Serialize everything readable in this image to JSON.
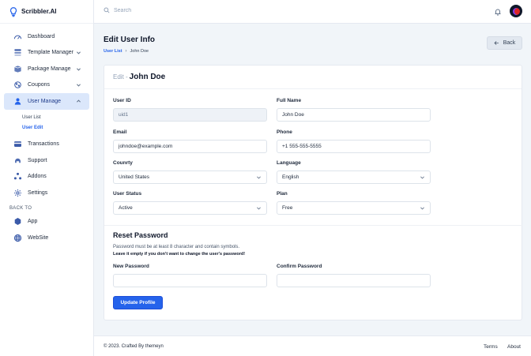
{
  "app": {
    "name": "Scribbler.AI",
    "brand_color": "#2563eb"
  },
  "sidebar": {
    "items": [
      {
        "label": "Dashboard",
        "icon": "dashboard-icon"
      },
      {
        "label": "Template Manager",
        "icon": "template-icon"
      },
      {
        "label": "Package Manage",
        "icon": "package-icon"
      },
      {
        "label": "Coupons",
        "icon": "coupon-icon"
      },
      {
        "label": "User Manage",
        "icon": "user-icon"
      },
      {
        "label": "Transactions",
        "icon": "transactions-icon"
      },
      {
        "label": "Support",
        "icon": "support-icon"
      },
      {
        "label": "Addons",
        "icon": "addons-icon"
      },
      {
        "label": "Settings",
        "icon": "settings-icon"
      }
    ],
    "user_sub": [
      "User List",
      "User Edit"
    ],
    "back_to_label": "BACK TO",
    "back_items": [
      {
        "label": "App",
        "icon": "app-icon"
      },
      {
        "label": "WebSite",
        "icon": "globe-icon"
      }
    ]
  },
  "topbar": {
    "search_placeholder": "Search"
  },
  "page": {
    "title": "Edit User Info",
    "breadcrumb": [
      "User List",
      "John Doe"
    ],
    "back_label": "Back"
  },
  "form": {
    "edit_prefix": "Edit -",
    "edit_name": "John Doe",
    "user_id": {
      "label": "User ID",
      "value": "uid1"
    },
    "full_name": {
      "label": "Full Name",
      "value": "John Doe"
    },
    "email": {
      "label": "Email",
      "value": "johndoe@example.com"
    },
    "phone": {
      "label": "Phone",
      "value": "+1 555-555-5555"
    },
    "country": {
      "label": "Counrty",
      "value": "United States"
    },
    "language": {
      "label": "Language",
      "value": "English"
    },
    "status": {
      "label": "User Status",
      "value": "Active"
    },
    "plan": {
      "label": "Plan",
      "value": "Free"
    },
    "reset": {
      "title": "Reset Password",
      "note": "Password must be at least 8 character and contain symbols.",
      "note2": "Leave it empty if you don't want to change the user's password!",
      "new_label": "New Password",
      "confirm_label": "Confirm Password"
    },
    "submit_label": "Update Profile"
  },
  "footer": {
    "copy": "© 2023. Crafted By themeyn",
    "terms": "Terms",
    "about": "About"
  }
}
